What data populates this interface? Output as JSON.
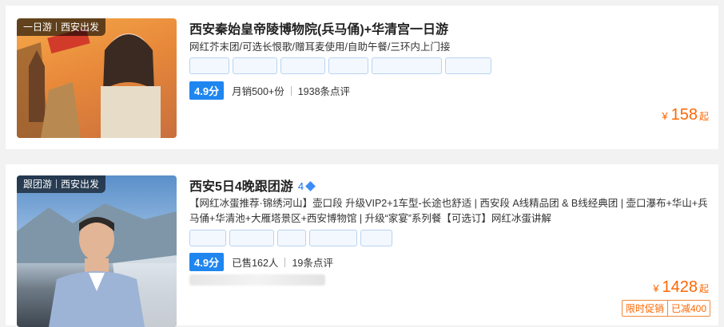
{
  "products": [
    {
      "tag_type": "一日游",
      "tag_origin": "西安出发",
      "title": "西安秦始皇帝陵博物院(兵马俑)+华清宫一日游",
      "subtitle": "网红芥末团/可选长恨歌/赠耳麦使用/自助午餐/三环内上门接",
      "score": "4.9分",
      "sales": "月销500+份",
      "reviews": "1938条点评",
      "currency": "¥",
      "price": "158",
      "price_suffix": "起"
    },
    {
      "tag_type": "跟团游",
      "tag_origin": "西安出发",
      "title": "西安5日4晚跟团游",
      "rank": "4",
      "subtitle": "【网红冰蛋推荐·锦绣河山】壶口段 升级VIP2+1车型-长途也舒适 | 西安段 A线精品团 & B线经典团 | 壶口瀑布+华山+兵马俑+华清池+大雁塔景区+西安博物馆 | 升级“家宴”系列餐【可选订】网红冰蛋讲解",
      "score": "4.9分",
      "sales": "已售162人",
      "reviews": "19条点评",
      "currency": "¥",
      "price": "1428",
      "price_suffix": "起",
      "promo_label": "限时促销",
      "promo_value": "已减400"
    }
  ],
  "colors": {
    "accent": "#1f86f0",
    "price": "#ff6600"
  },
  "icons": [
    "diamond-icon"
  ]
}
